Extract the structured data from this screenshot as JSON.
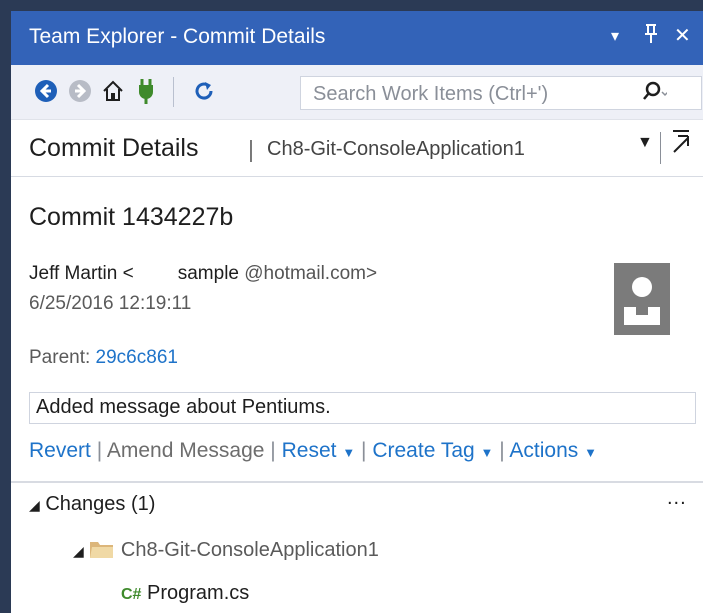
{
  "window": {
    "title": "Team Explorer - Commit Details",
    "controls": [
      "▾",
      "ᛘ",
      "✕"
    ]
  },
  "toolbar": {
    "search_placeholder": "Search Work Items (Ctrl+')",
    "icons": [
      "back-icon",
      "forward-icon",
      "home-icon",
      "connect-icon",
      "refresh-icon",
      "search-icon"
    ]
  },
  "header": {
    "title": "Commit Details",
    "separator": "|",
    "subtitle": "Ch8-Git-ConsoleApplication1"
  },
  "commit": {
    "title": "Commit 1434227b",
    "author_name": "Jeff Martin <",
    "author_user": "sample",
    "author_domain": "@hotmail.com>",
    "date": "6/25/2016 12:19:11",
    "parent_label": "Parent:",
    "parent_id": "29c6c861",
    "message": "Added message about Pentiums."
  },
  "actions": {
    "revert": "Revert",
    "amend": "Amend Message",
    "reset": "Reset",
    "create_tag": "Create Tag",
    "actions": "Actions"
  },
  "changes": {
    "header": "Changes (1)",
    "more": "...",
    "folder": "Ch8-Git-ConsoleApplication1",
    "file_badge": "C#",
    "file": "Program.cs"
  },
  "colors": {
    "title_bar": "#3363b8",
    "link": "#1e73c9",
    "csharp": "#3e8a2b"
  }
}
